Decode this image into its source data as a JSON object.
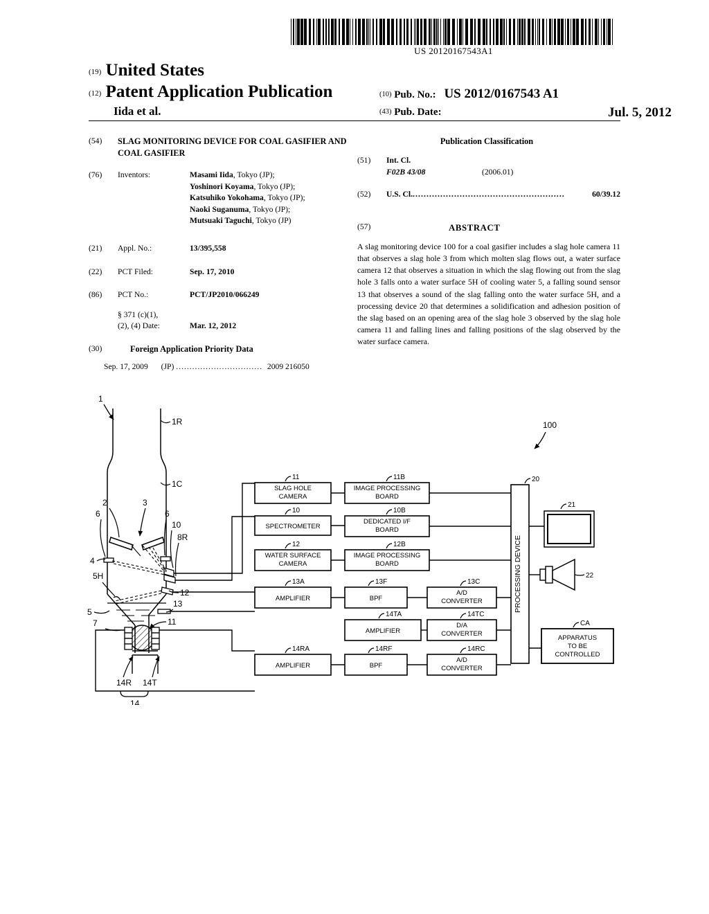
{
  "header": {
    "barcode_number": "US 20120167543A1",
    "kind_19": "(19)",
    "country": "United States",
    "kind_12": "(12)",
    "doc_type": "Patent Application Publication",
    "applicant_line": "Iida et al.",
    "kind_10": "(10)",
    "pubno_label": "Pub. No.:",
    "pubno_value": "US 2012/0167543 A1",
    "kind_43": "(43)",
    "pubdate_label": "Pub. Date:",
    "pubdate_value": "Jul. 5, 2012"
  },
  "left_column": {
    "title_num": "(54)",
    "title_text": "SLAG MONITORING DEVICE FOR COAL GASIFIER AND COAL GASIFIER",
    "inventors_num": "(76)",
    "inventors_label": "Inventors:",
    "inventors": [
      {
        "name": "Masami Iida",
        "location": ", Tokyo (JP);"
      },
      {
        "name": "Yoshinori Koyama",
        "location": ", Tokyo (JP);"
      },
      {
        "name": "Katsuhiko Yokohama",
        "location": ", Tokyo (JP);"
      },
      {
        "name": "Naoki Suganuma",
        "location": ", Tokyo (JP);"
      },
      {
        "name": "Mutsuaki Taguchi",
        "location": ", Tokyo (JP)"
      }
    ],
    "appl_num": "(21)",
    "appl_label": "Appl. No.:",
    "appl_value": "13/395,558",
    "pct_filed_num": "(22)",
    "pct_filed_label": "PCT Filed:",
    "pct_filed_value": "Sep. 17, 2010",
    "pct_no_num": "(86)",
    "pct_no_label": "PCT No.:",
    "pct_no_value": "PCT/JP2010/066249",
    "sec371_line1": "§ 371 (c)(1),",
    "sec371_line2": "(2), (4) Date:",
    "sec371_date": "Mar. 12, 2012",
    "foreign_num": "(30)",
    "foreign_header": "Foreign Application Priority Data",
    "foreign_date": "Sep. 17, 2009",
    "foreign_country": "(JP)",
    "foreign_dots": "................................",
    "foreign_value": "2009 216050"
  },
  "right_column": {
    "pubclass_header": "Publication Classification",
    "intcl_num": "(51)",
    "intcl_label": "Int. Cl.",
    "intcl_code": "F02B  43/08",
    "intcl_version": "(2006.01)",
    "uscl_num": "(52)",
    "uscl_label": "U.S. Cl.",
    "uscl_dots": ".......................................................",
    "uscl_value": "60/39.12",
    "abstract_num": "(57)",
    "abstract_header": "ABSTRACT",
    "abstract_text": "A slag monitoring device 100 for a coal gasifier includes a slag hole camera 11 that observes a slag hole 3 from which molten slag flows out, a water surface camera 12 that observes a situation in which the slag flowing out from the slag hole 3 falls onto a water surface 5H of cooling water 5, a falling sound sensor 13 that observes a sound of the slag falling onto the water surface 5H, and a processing device 20 that determines a solidification and adhesion position of the slag based on an opening area of the slag hole 3 observed by the slag hole camera 11 and falling lines and falling positions of the slag observed by the water surface camera."
  },
  "figure": {
    "system_label": "100",
    "gasifier_labels": [
      {
        "id": "1",
        "text": "1"
      },
      {
        "id": "1R",
        "text": "1R"
      },
      {
        "id": "1C",
        "text": "1C"
      },
      {
        "id": "2",
        "text": "2"
      },
      {
        "id": "3",
        "text": "3"
      },
      {
        "id": "4",
        "text": "4"
      },
      {
        "id": "5",
        "text": "5"
      },
      {
        "id": "5H",
        "text": "5H"
      },
      {
        "id": "6a",
        "text": "6"
      },
      {
        "id": "6b",
        "text": "6"
      },
      {
        "id": "7",
        "text": "7"
      },
      {
        "id": "8R",
        "text": "8R"
      },
      {
        "id": "10",
        "text": "10"
      },
      {
        "id": "11",
        "text": "11"
      },
      {
        "id": "12",
        "text": "12"
      },
      {
        "id": "13",
        "text": "13"
      },
      {
        "id": "14",
        "text": "14"
      },
      {
        "id": "14R",
        "text": "14R"
      },
      {
        "id": "14T",
        "text": "14T"
      }
    ],
    "blocks": [
      {
        "ref": "11",
        "lines": [
          "SLAG HOLE",
          "CAMERA"
        ]
      },
      {
        "ref": "11B",
        "lines": [
          "IMAGE PROCESSING",
          "BOARD"
        ]
      },
      {
        "ref": "10",
        "lines": [
          "SPECTROMETER"
        ]
      },
      {
        "ref": "10B",
        "lines": [
          "DEDICATED I/F",
          "BOARD"
        ]
      },
      {
        "ref": "12",
        "lines": [
          "WATER SURFACE",
          "CAMERA"
        ]
      },
      {
        "ref": "12B",
        "lines": [
          "IMAGE PROCESSING",
          "BOARD"
        ]
      },
      {
        "ref": "13A",
        "lines": [
          "AMPLIFIER"
        ]
      },
      {
        "ref": "13F",
        "lines": [
          "BPF"
        ]
      },
      {
        "ref": "13C",
        "lines": [
          "A/D",
          "CONVERTER"
        ]
      },
      {
        "ref": "14TA",
        "lines": [
          "AMPLIFIER"
        ]
      },
      {
        "ref": "14TC",
        "lines": [
          "D/A",
          "CONVERTER"
        ]
      },
      {
        "ref": "14RA",
        "lines": [
          "AMPLIFIER"
        ]
      },
      {
        "ref": "14RF",
        "lines": [
          "BPF"
        ]
      },
      {
        "ref": "14RC",
        "lines": [
          "A/D",
          "CONVERTER"
        ]
      }
    ],
    "processing_device": {
      "ref": "20",
      "label": "PROCESSING DEVICE"
    },
    "monitor": {
      "ref": "21"
    },
    "speaker": {
      "ref": "22"
    },
    "apparatus": {
      "ref": "CA",
      "lines": [
        "APPARATUS",
        "TO BE",
        "CONTROLLED"
      ]
    }
  }
}
